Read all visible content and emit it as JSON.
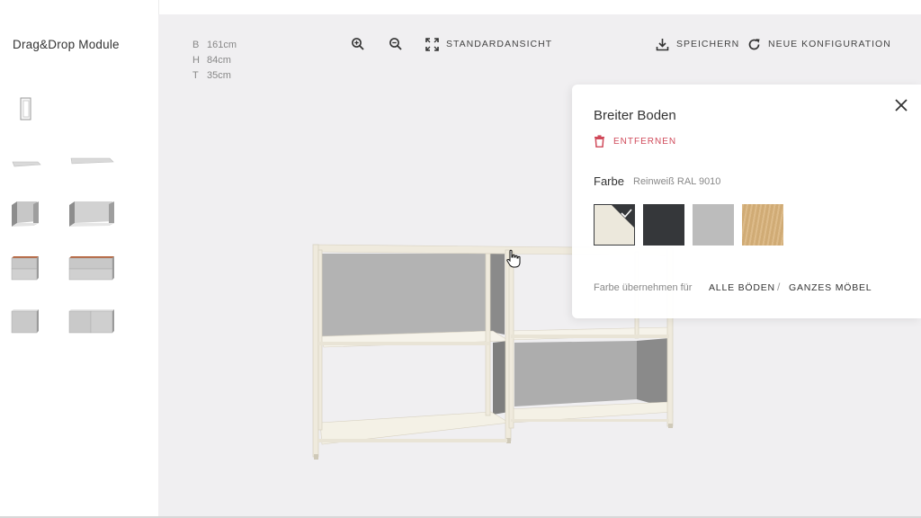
{
  "sidebar": {
    "title": "Drag&Drop Module",
    "modules": [
      "panel-module",
      "shelf-narrow-module",
      "shelf-wide-module",
      "open-box-narrow-module",
      "open-box-wide-module",
      "drawer-narrow-module",
      "drawer-wide-module",
      "closed-box-narrow-module",
      "closed-box-wide-module"
    ]
  },
  "dimensions": {
    "width_label": "B",
    "width_value": "161cm",
    "height_label": "H",
    "height_value": "84cm",
    "depth_label": "T",
    "depth_value": "35cm"
  },
  "toolbar": {
    "standard_view": "STANDARDANSICHT",
    "save": "SPEICHERN",
    "new_config": "NEUE KONFIGURATION"
  },
  "panel": {
    "title": "Breiter Boden",
    "remove": "ENTFERNEN",
    "color_label": "Farbe",
    "color_value": "Reinweiß RAL 9010",
    "swatches": [
      {
        "color": "#ece8dc",
        "selected": true
      },
      {
        "color": "#35373a",
        "selected": false
      },
      {
        "color": "#bcbcbc",
        "selected": false
      },
      {
        "color": "#d8b27a",
        "selected": false
      }
    ],
    "apply_label": "Farbe übernehmen für",
    "apply_all_shelves": "ALLE BÖDEN",
    "separator": "/",
    "apply_whole_furniture": "GANZES MÖBEL"
  },
  "colors": {
    "accent_red": "#d04a5a",
    "frame": "#efeadd",
    "back_panel": "#b3b3b3"
  }
}
